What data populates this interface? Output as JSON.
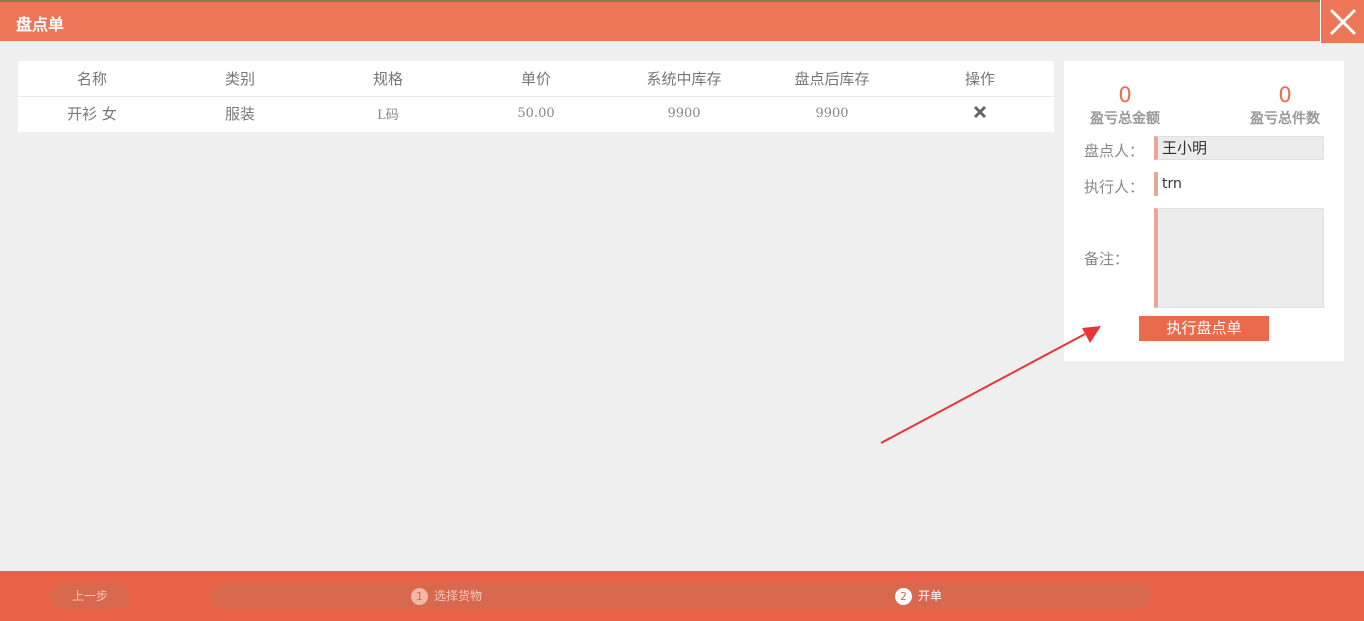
{
  "window": {
    "title": "盘点单"
  },
  "table": {
    "headers": [
      "名称",
      "类别",
      "规格",
      "单价",
      "系统中库存",
      "盘点后库存",
      "操作"
    ],
    "rows": [
      {
        "name": "开衫 女",
        "category": "服装",
        "spec": "L码",
        "price": "50.00",
        "system_stock": "9900",
        "after_stock": "9900"
      }
    ]
  },
  "summary": {
    "loss_amount_value": "0",
    "loss_amount_label": "盈亏总金额",
    "loss_count_value": "0",
    "loss_count_label": "盈亏总件数"
  },
  "form": {
    "checker_label": "盘点人：",
    "checker_value": "王小明",
    "executor_label": "执行人：",
    "executor_value": "trn",
    "remark_label": "备注：",
    "remark_value": "",
    "submit_label": "执行盘点单"
  },
  "footer": {
    "prev_label": "上一步",
    "steps": [
      {
        "num": "1",
        "label": "选择货物"
      },
      {
        "num": "2",
        "label": "开单"
      }
    ]
  },
  "colors": {
    "accent": "#ee7658",
    "bottom_bar": "#e96146",
    "arrow": "#e8343a"
  }
}
